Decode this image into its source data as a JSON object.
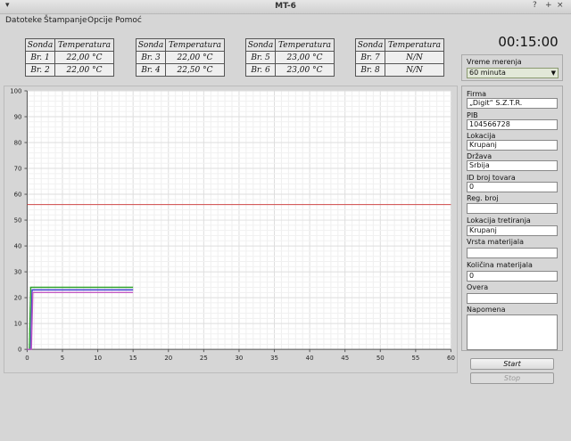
{
  "window": {
    "title": "MT-6",
    "controls": {
      "menu": "▾",
      "help": "?",
      "minimize": "–",
      "maximize": "+",
      "close": "×"
    }
  },
  "menu": [
    "Datoteke",
    "Štampanje",
    "Opcije",
    "Pomoć"
  ],
  "probe_tables": [
    {
      "header": [
        "Sonda",
        "Temperatura"
      ],
      "rows": [
        [
          "Br. 1",
          "22,00 °C"
        ],
        [
          "Br. 2",
          "22,00 °C"
        ]
      ]
    },
    {
      "header": [
        "Sonda",
        "Temperatura"
      ],
      "rows": [
        [
          "Br. 3",
          "22,00 °C"
        ],
        [
          "Br. 4",
          "22,50 °C"
        ]
      ]
    },
    {
      "header": [
        "Sonda",
        "Temperatura"
      ],
      "rows": [
        [
          "Br. 5",
          "23,00 °C"
        ],
        [
          "Br. 6",
          "23,00 °C"
        ]
      ]
    },
    {
      "header": [
        "Sonda",
        "Temperatura"
      ],
      "rows": [
        [
          "Br. 7",
          "N/N"
        ],
        [
          "Br. 8",
          "N/N"
        ]
      ]
    }
  ],
  "clock": "00:15:00",
  "measurement_time": {
    "label": "Vreme merenja",
    "value": "60 minuta"
  },
  "form": {
    "firma": {
      "label": "Firma",
      "value": "„Digit“ S.Z.T.R."
    },
    "pib": {
      "label": "PIB",
      "value": "104566728"
    },
    "lokacija": {
      "label": "Lokacija",
      "value": "Krupanj"
    },
    "drzava": {
      "label": "Država",
      "value": "Srbija"
    },
    "id_broj_tovara": {
      "label": "ID broj tovara",
      "value": "0"
    },
    "reg_broj": {
      "label": "Reg. broj",
      "value": ""
    },
    "lokacija_tretiranja": {
      "label": "Lokacija tretiranja",
      "value": "Krupanj"
    },
    "vrsta_materijala": {
      "label": "Vrsta materijala",
      "value": ""
    },
    "kolicina_materijala": {
      "label": "Količina materijala",
      "value": "0"
    },
    "overa": {
      "label": "Overa",
      "value": ""
    },
    "napomena": {
      "label": "Napomena",
      "value": ""
    }
  },
  "buttons": {
    "start": "Start",
    "stop": "Stop"
  },
  "chart_data": {
    "type": "line",
    "xlim": [
      0,
      60
    ],
    "ylim": [
      0,
      100
    ],
    "x_ticks": [
      0,
      5,
      10,
      15,
      20,
      25,
      30,
      35,
      40,
      45,
      50,
      55,
      60
    ],
    "y_ticks": [
      0,
      10,
      20,
      30,
      40,
      50,
      60,
      70,
      80,
      90,
      100
    ],
    "grid": true,
    "series": [
      {
        "color": "#2ca02c",
        "x": [
          0,
          0.3,
          0.5,
          15
        ],
        "y": [
          0,
          0,
          24,
          24
        ]
      },
      {
        "color": "#3b3bd0",
        "x": [
          0,
          0.5,
          0.7,
          15
        ],
        "y": [
          0,
          0,
          23,
          23
        ]
      },
      {
        "color": "#c25ac2",
        "x": [
          0,
          0.6,
          0.8,
          15
        ],
        "y": [
          0,
          0,
          22,
          22
        ]
      }
    ],
    "threshold": {
      "color": "#d04848",
      "y": 56
    }
  }
}
